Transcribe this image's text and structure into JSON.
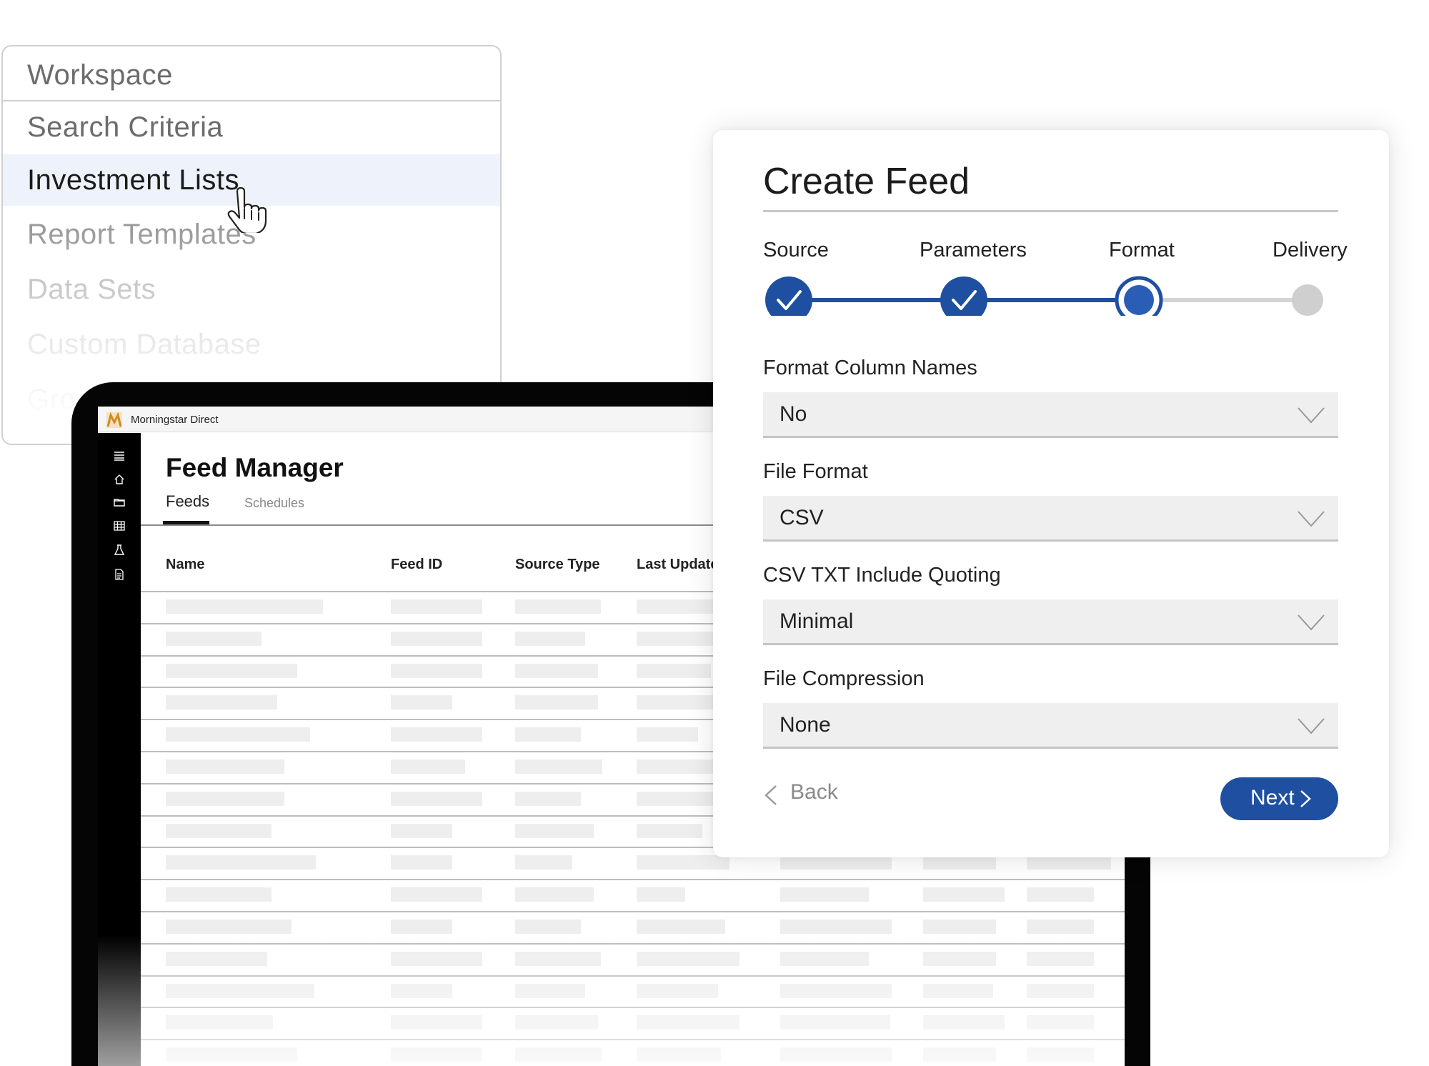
{
  "workspace": {
    "header": "Workspace",
    "items": [
      {
        "label": "Search Criteria"
      },
      {
        "label": "Investment Lists"
      },
      {
        "label": "Report Templates"
      },
      {
        "label": "Data Sets"
      },
      {
        "label": "Custom Database"
      },
      {
        "label": "Gro"
      }
    ]
  },
  "app": {
    "window_title": "Morningstar Direct",
    "page_title": "Feed Manager",
    "tabs": [
      {
        "label": "Feeds"
      },
      {
        "label": "Schedules"
      }
    ],
    "table": {
      "columns": [
        "Name",
        "Feed ID",
        "Source Type",
        "Last Update"
      ]
    },
    "rail_icons": [
      "menu-icon",
      "home-icon",
      "folder-icon",
      "grid-icon",
      "flask-icon",
      "document-icon"
    ]
  },
  "create_feed": {
    "title": "Create Feed",
    "steps": [
      {
        "label": "Source",
        "state": "complete"
      },
      {
        "label": "Parameters",
        "state": "complete"
      },
      {
        "label": "Format",
        "state": "current"
      },
      {
        "label": "Delivery",
        "state": "pending"
      }
    ],
    "fields": [
      {
        "label": "Format Column Names",
        "value": "No"
      },
      {
        "label": "File Format",
        "value": "CSV"
      },
      {
        "label": "CSV TXT Include Quoting",
        "value": "Minimal"
      },
      {
        "label": "File Compression",
        "value": "None"
      }
    ],
    "back_label": "Back",
    "next_label": "Next",
    "colors": {
      "accent": "#1f4fa0",
      "pending": "#cfcfcf"
    }
  }
}
